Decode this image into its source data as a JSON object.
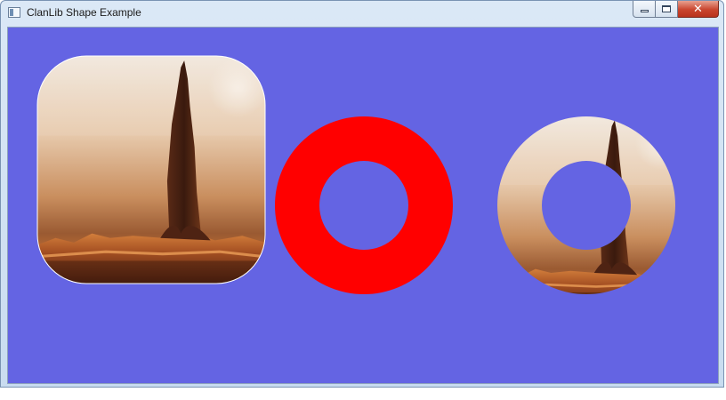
{
  "window": {
    "title": "ClanLib Shape Example",
    "icon": "app-window-icon",
    "controls": {
      "minimize_icon": "minimize-icon",
      "maximize_icon": "maximize-icon",
      "close_icon": "close-icon",
      "close_glyph": "✕"
    }
  },
  "canvas": {
    "background_color": "#6464e3",
    "shapes": [
      {
        "name": "rounded-rect-textured",
        "fill": "landscape-texture"
      },
      {
        "name": "red-ring",
        "color": "#ff0000"
      },
      {
        "name": "textured-ring",
        "fill": "landscape-texture"
      }
    ]
  }
}
